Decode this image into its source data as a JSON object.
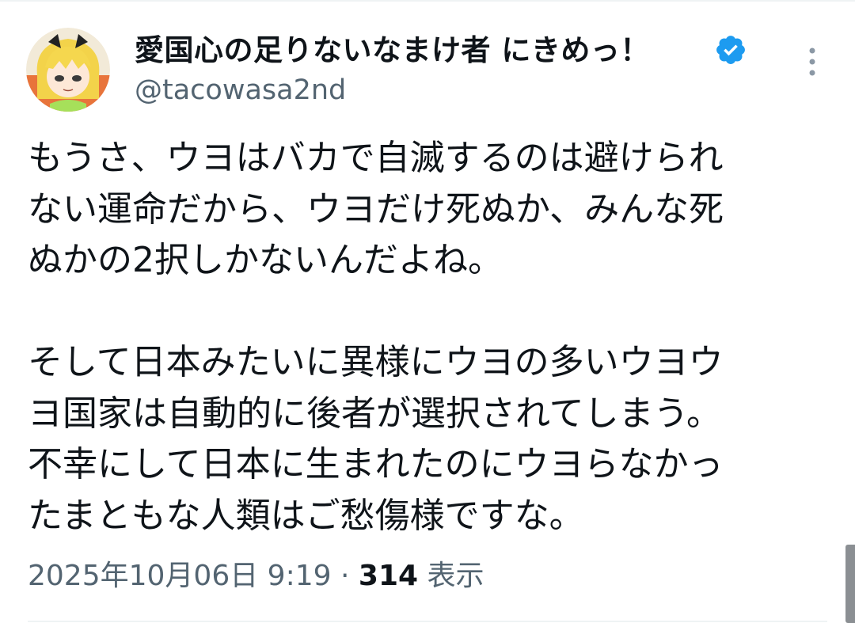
{
  "author": {
    "display_name": "愛国心の足りないなまけ者 にきめっ！",
    "handle": "@tacowasa2nd",
    "verified": true,
    "avatar_icon": "anime-avatar-icon"
  },
  "tweet": {
    "lines": [
      "もうさ、ウヨはバカで自滅するのは避けられ",
      "ない運命だから、ウヨだけ死ぬか、みんな死",
      "ぬかの2択しかないんだよね。",
      "",
      "そして日本みたいに異様にウヨの多いウヨウ",
      "ヨ国家は自動的に後者が選択されてしまう。",
      "不幸にして日本に生まれたのにウヨらなかっ",
      "たまともな人類はご愁傷様ですな。"
    ],
    "timestamp": "2025年10月06日 9:19",
    "separator": "·",
    "views_count": "314",
    "views_label": "表示"
  },
  "colors": {
    "verified_blue": "#1d9bf0",
    "secondary_text": "#536471",
    "primary_text": "#0f1419",
    "divider": "#eff3f4"
  }
}
